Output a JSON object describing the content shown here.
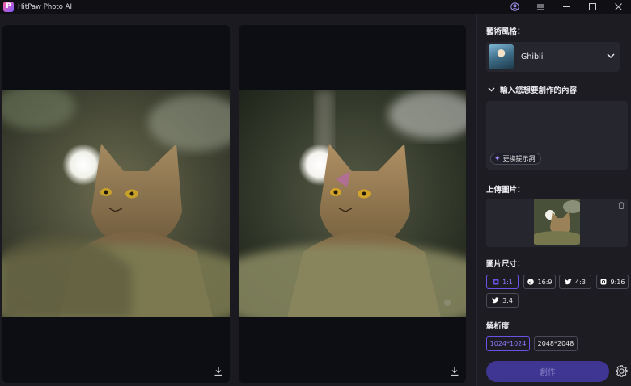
{
  "window": {
    "app_title": "HitPaw Photo AI",
    "icons": [
      "account-icon",
      "menu-icon",
      "minimize-icon",
      "maximize-icon",
      "close-icon"
    ]
  },
  "canvas": {
    "left_panel": {
      "download_icon": "download-icon"
    },
    "right_panel": {
      "download_icon": "download-icon"
    }
  },
  "sidebar": {
    "style_label": "藝術風格：",
    "style_value": "Ghibli",
    "prompt_label": "輸入您想要創作的內容",
    "prompt_value": "",
    "swap_prompt_label": "更換提示詞",
    "upload_label": "上傳圖片：",
    "size_label": "圖片尺寸：",
    "ratios": [
      {
        "label": "1:1",
        "icon": "square-icon",
        "active": true
      },
      {
        "label": "16:9",
        "icon": "tiktok-icon",
        "active": false
      },
      {
        "label": "4:3",
        "icon": "twitter-icon",
        "active": false
      },
      {
        "label": "9:16",
        "icon": "instagram-icon",
        "active": false
      },
      {
        "label": "3:4",
        "icon": "twitter-icon",
        "active": false
      }
    ],
    "resolution_label": "解析度",
    "resolutions": [
      {
        "label": "1024*1024",
        "active": true
      },
      {
        "label": "2048*2048",
        "active": false
      }
    ],
    "create_label": "創作"
  },
  "colors": {
    "accent": "#6a52e6",
    "create_button": "#3f3694"
  }
}
